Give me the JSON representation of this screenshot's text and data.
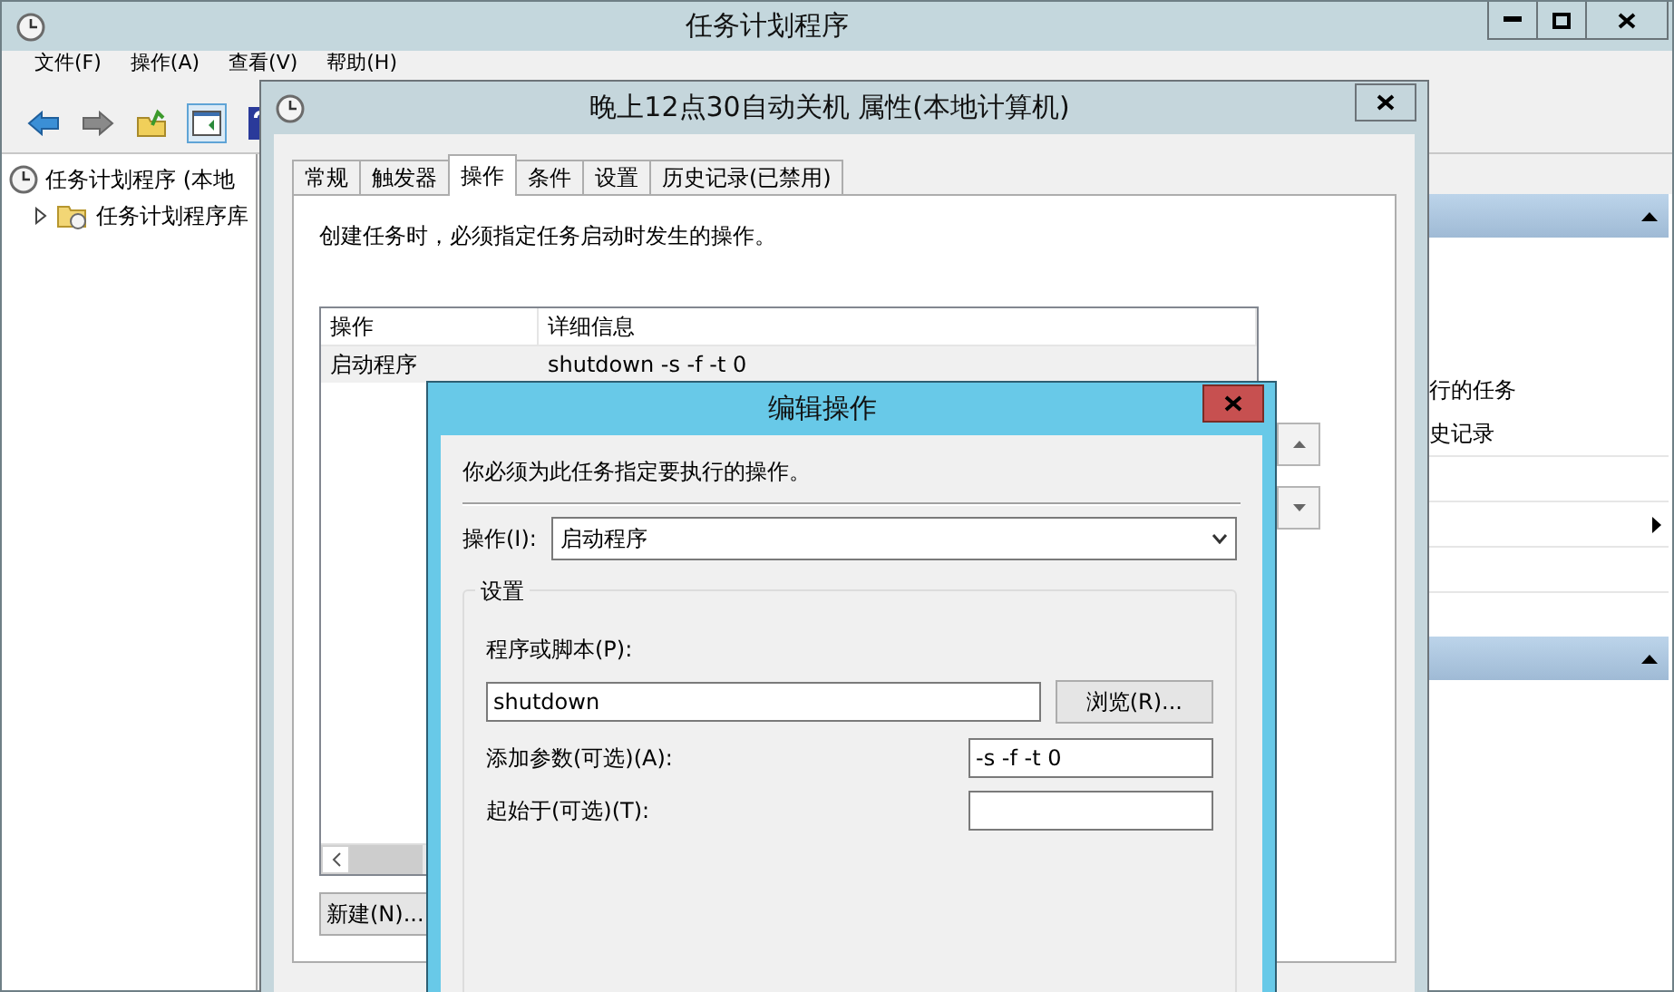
{
  "main_window": {
    "title": "任务计划程序",
    "menu": [
      "文件(F)",
      "操作(A)",
      "查看(V)",
      "帮助(H)"
    ],
    "tree": [
      {
        "label": "任务计划程序 (本地",
        "children": [
          {
            "label": "任务计划程序库",
            "expanded": false
          }
        ]
      }
    ],
    "actions_pane": {
      "items": [
        "行的任务",
        "史记录"
      ]
    }
  },
  "properties_dialog": {
    "title": "晚上12点30自动关机 属性(本地计算机)",
    "tabs": [
      {
        "label": "常规",
        "selected": false
      },
      {
        "label": "触发器",
        "selected": false
      },
      {
        "label": "操作",
        "selected": true
      },
      {
        "label": "条件",
        "selected": false
      },
      {
        "label": "设置",
        "selected": false
      },
      {
        "label": "历史记录(已禁用)",
        "selected": false
      }
    ],
    "description": "创建任务时，必须指定任务启动时发生的操作。",
    "table": {
      "columns": [
        "操作",
        "详细信息"
      ],
      "rows": [
        [
          "启动程序",
          "shutdown -s -f -t 0"
        ]
      ]
    },
    "new_button": "新建(N)..."
  },
  "edit_dialog": {
    "title": "编辑操作",
    "description": "你必须为此任务指定要执行的操作。",
    "action_label": "操作(I):",
    "action_value": "启动程序",
    "group_title": "设置",
    "program_label": "程序或脚本(P):",
    "program_value": "shutdown",
    "browse_button": "浏览(R)...",
    "arguments_label": "添加参数(可选)(A):",
    "arguments_value": "-s -f -t 0",
    "start_in_label": "起始于(可选)(T):"
  }
}
